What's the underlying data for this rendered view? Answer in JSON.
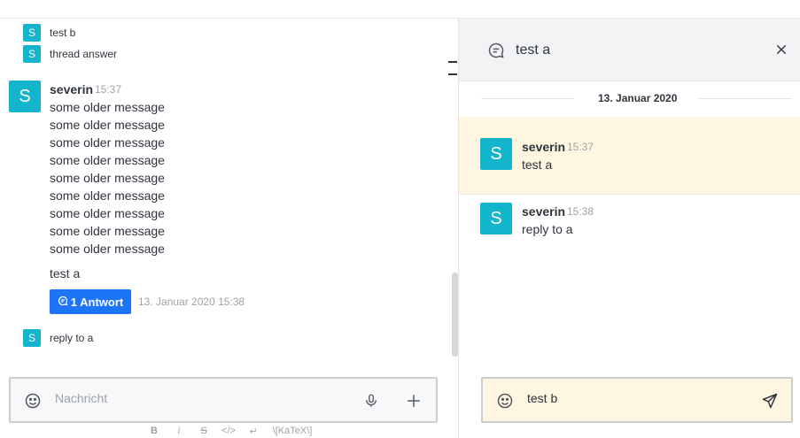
{
  "left": {
    "sequential": [
      {
        "avatar": "S",
        "text": "test b"
      },
      {
        "avatar": "S",
        "text": "thread answer"
      }
    ],
    "message": {
      "avatar": "S",
      "username": "severin",
      "time": "15:37",
      "lines": [
        "some older message",
        "some older message",
        "some older message",
        "some older message",
        "some older message",
        "some older message",
        "some older message",
        "some older message",
        "some older message"
      ],
      "thread_text": "test a",
      "reply_button": "1 Antwort",
      "reply_meta": "13. Januar 2020 15:38"
    },
    "last": {
      "avatar": "S",
      "text": "reply to a"
    },
    "composer": {
      "placeholder": "Nachricht",
      "icons": [
        "emoji-icon",
        "microphone-icon",
        "plus-icon"
      ]
    },
    "format_bar": [
      "B",
      "i",
      "S",
      "</>",
      "↵",
      "\\[KaTeX\\]"
    ]
  },
  "thread": {
    "title": "test a",
    "date": "13. Januar 2020",
    "messages": [
      {
        "avatar": "S",
        "username": "severin",
        "time": "15:37",
        "text": "test a"
      },
      {
        "avatar": "S",
        "username": "severin",
        "time": "15:38",
        "text": "reply to a"
      }
    ],
    "composer_value": "test b"
  },
  "colors": {
    "avatar": "#12b5cb",
    "reply_button": "#1d74f5",
    "highlight": "#fff6e2"
  }
}
